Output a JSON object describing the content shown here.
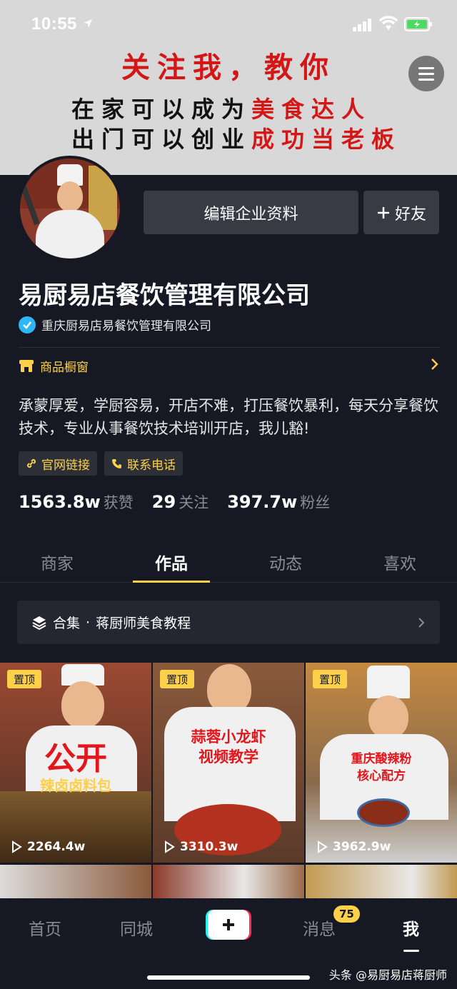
{
  "status_bar": {
    "time": "10:55"
  },
  "banner": {
    "line1": "关注我，教你",
    "line2_black": "在家可以成为",
    "line2_red": "美食达人",
    "line3_black": "出门可以创业",
    "line3_red": "成功当老板"
  },
  "profile": {
    "edit_button": "编辑企业资料",
    "friend_button": "好友",
    "name": "易厨易店餐饮管理有限公司",
    "verified_org": "重庆厨易店易餐饮管理有限公司",
    "shop_label": "商品橱窗",
    "bio": "承蒙厚爱，学厨容易，开店不难，打压餐饮暴利，每天分享餐饮技术，专业从事餐饮技术培训开店，我儿豁!",
    "tags": [
      "官网链接",
      "联系电话"
    ],
    "stats": [
      {
        "num": "1563.8w",
        "label": "获赞"
      },
      {
        "num": "29",
        "label": "关注"
      },
      {
        "num": "397.7w",
        "label": "粉丝"
      }
    ]
  },
  "tabs": [
    "商家",
    "作品",
    "动态",
    "喜欢"
  ],
  "active_tab": "作品",
  "collection": {
    "prefix": "合集",
    "dot": "·",
    "title": "蒋厨师美食教程"
  },
  "videos": [
    {
      "pin": "置顶",
      "views": "2264.4w",
      "caption1": "公开",
      "caption2": "辣卤卤料包"
    },
    {
      "pin": "置顶",
      "views": "3310.3w",
      "caption1": "蒜蓉小龙虾",
      "caption2": "视频教学"
    },
    {
      "pin": "置顶",
      "views": "3962.9w",
      "caption1": "重庆酸辣粉",
      "caption2": "核心配方"
    }
  ],
  "bottom_nav": {
    "home": "首页",
    "nearby": "同城",
    "messages": "消息",
    "messages_badge": "75",
    "me": "我"
  },
  "watermark": "头条 @易厨易店蒋厨师",
  "colors": {
    "accent": "#fcd04a",
    "background": "#161823",
    "banner_red": "#d31616"
  }
}
